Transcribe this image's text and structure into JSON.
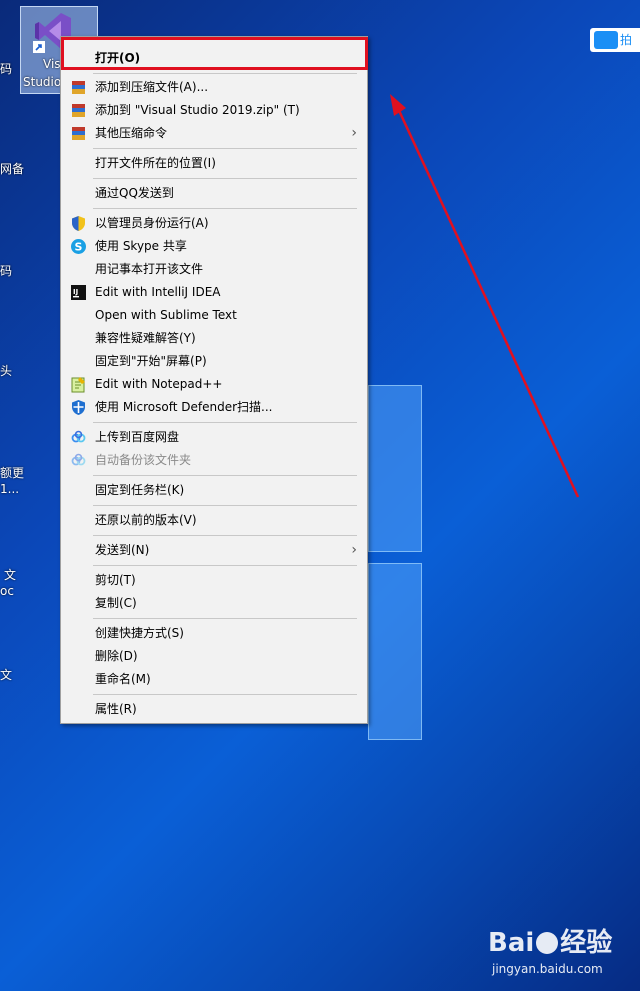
{
  "desktop": {
    "icon_label_line1": "Visu",
    "icon_label_line2": "Studio",
    "left_fragments": [
      "码",
      "网备",
      "码",
      "头",
      "额更",
      "1...",
      "文",
      "oc",
      "文"
    ]
  },
  "context_menu": {
    "items": [
      {
        "label": "打开(O)",
        "icon": "none"
      },
      {
        "label": "添加到压缩文件(A)...",
        "icon": "winrar-icon"
      },
      {
        "label": "添加到 \"Visual Studio 2019.zip\" (T)",
        "icon": "winrar-icon"
      },
      {
        "label": "其他压缩命令",
        "icon": "winrar-icon",
        "submenu": true
      },
      {
        "label": "打开文件所在的位置(I)",
        "icon": "none"
      },
      {
        "label": "通过QQ发送到",
        "icon": "none"
      },
      {
        "label": "以管理员身份运行(A)",
        "icon": "uac-shield-icon"
      },
      {
        "label": "使用 Skype 共享",
        "icon": "skype-icon"
      },
      {
        "label": "用记事本打开该文件",
        "icon": "none"
      },
      {
        "label": "Edit with IntelliJ IDEA",
        "icon": "intellij-icon"
      },
      {
        "label": "Open with Sublime Text",
        "icon": "none"
      },
      {
        "label": "兼容性疑难解答(Y)",
        "icon": "none"
      },
      {
        "label": "固定到\"开始\"屏幕(P)",
        "icon": "none"
      },
      {
        "label": "Edit with Notepad++",
        "icon": "notepadpp-icon"
      },
      {
        "label": "使用 Microsoft Defender扫描...",
        "icon": "defender-icon"
      },
      {
        "label": "上传到百度网盘",
        "icon": "baidu-netdisk-icon"
      },
      {
        "label": "自动备份该文件夹",
        "icon": "baidu-netdisk-icon",
        "disabled": true
      },
      {
        "label": "固定到任务栏(K)",
        "icon": "none"
      },
      {
        "label": "还原以前的版本(V)",
        "icon": "none"
      },
      {
        "label": "发送到(N)",
        "icon": "none",
        "submenu": true
      },
      {
        "label": "剪切(T)",
        "icon": "none"
      },
      {
        "label": "复制(C)",
        "icon": "none"
      },
      {
        "label": "创建快捷方式(S)",
        "icon": "none"
      },
      {
        "label": "删除(D)",
        "icon": "none"
      },
      {
        "label": "重命名(M)",
        "icon": "none"
      },
      {
        "label": "属性(R)",
        "icon": "none"
      }
    ],
    "submenu_arrow": "›"
  },
  "baidu_pill": {
    "text": "拍"
  },
  "watermark": {
    "brand": "Bai",
    "brand2": "经验",
    "url": "jingyan.baidu.com"
  },
  "colors": {
    "highlight": "#e01020",
    "arrow": "#e01020"
  }
}
